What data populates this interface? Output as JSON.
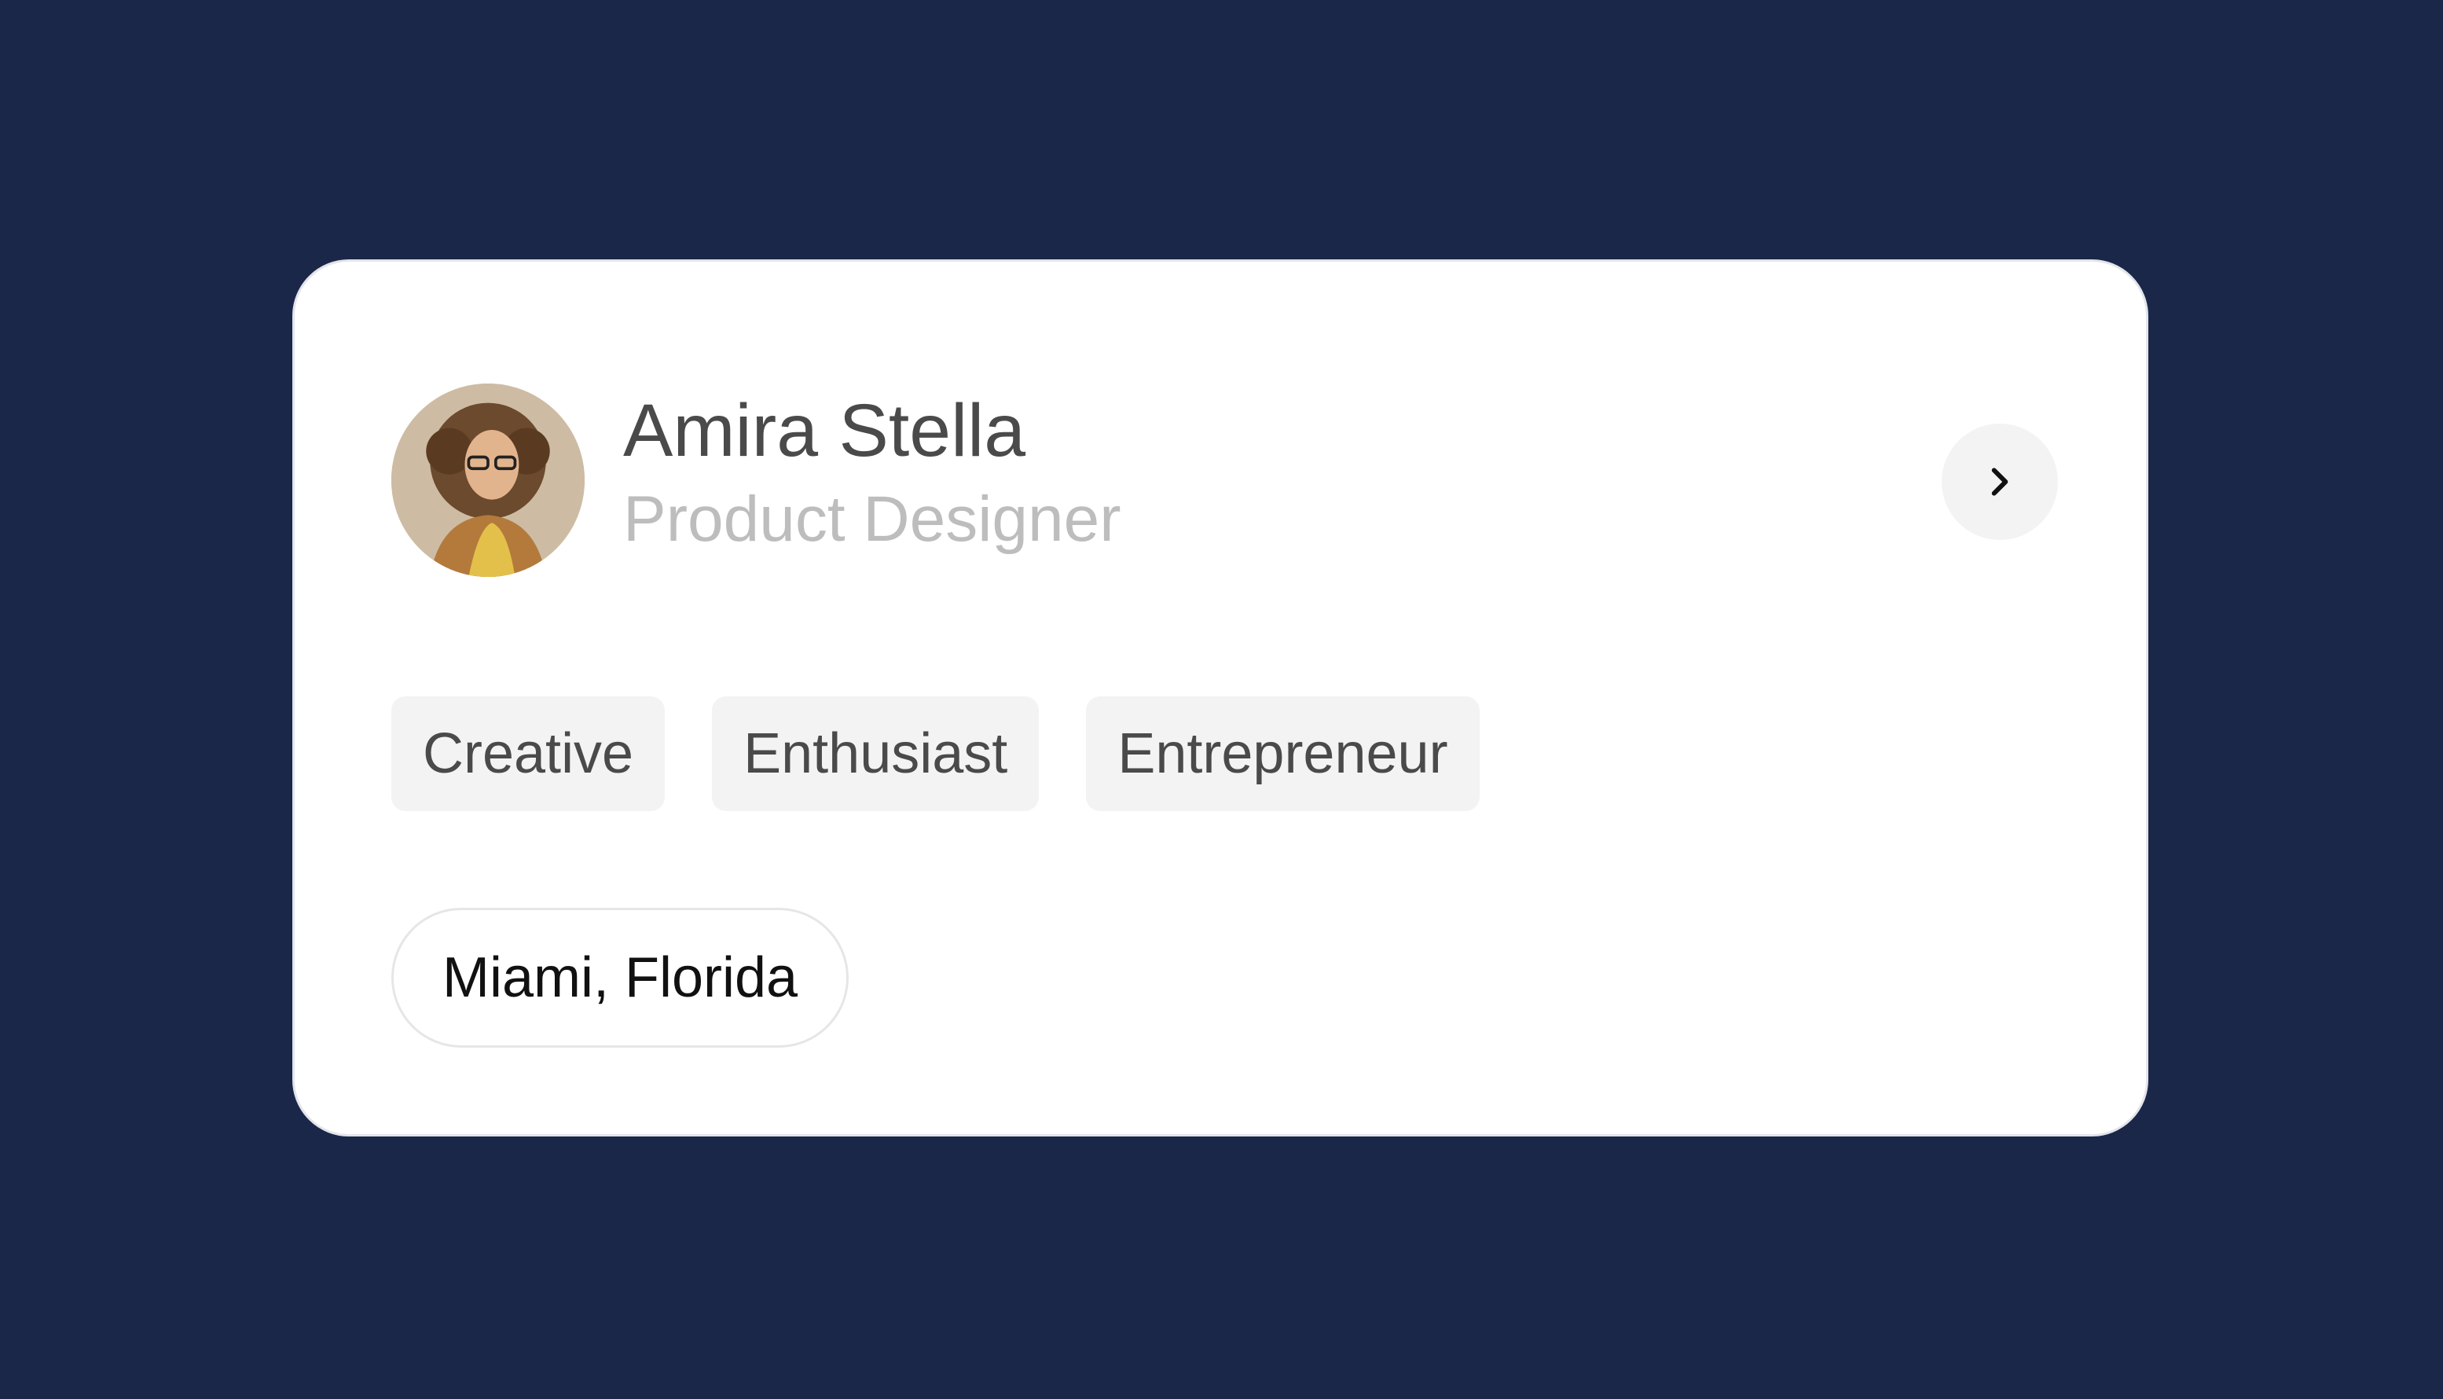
{
  "profile": {
    "name": "Amira Stella",
    "role": "Product Designer",
    "tags": [
      "Creative",
      "Enthusiast",
      "Entrepreneur"
    ],
    "location": "Miami, Florida"
  },
  "icons": {
    "avatar": "user-photo",
    "next": "chevron-right-icon"
  },
  "colors": {
    "background": "#1a2749",
    "card": "#ffffff",
    "tag_bg": "#f3f3f3",
    "name_text": "#4a4a4a",
    "role_text": "#bdbdbd"
  }
}
